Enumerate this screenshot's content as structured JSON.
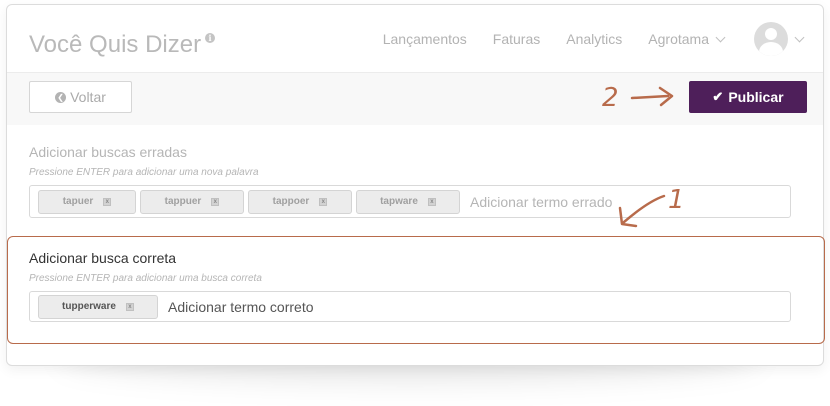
{
  "header": {
    "title": "Você Quis Dizer",
    "nav": [
      "Lançamentos",
      "Faturas",
      "Analytics"
    ],
    "account": "Agrotama"
  },
  "toolbar": {
    "back_label": "Voltar",
    "publish_label": "Publicar"
  },
  "wrong_section": {
    "label": "Adicionar buscas erradas",
    "hint": "Pressione ENTER para adicionar uma nova palavra",
    "tags": [
      "tapuer",
      "tappuer",
      "tappoer",
      "tapware"
    ],
    "placeholder": "Adicionar termo errado"
  },
  "correct_section": {
    "label": "Adicionar busca correta",
    "hint": "Pressione ENTER para adicionar uma busca correta",
    "tags": [
      "tupperware"
    ],
    "placeholder": "Adicionar termo correto"
  },
  "annotations": {
    "step_one": "1",
    "step_two": "2"
  },
  "colors": {
    "publish": "#4e1f5a",
    "annotation": "#b86b4b"
  },
  "icons": {
    "title_info": "info-icon",
    "back": "chevron-left-circle-icon",
    "publish": "check-icon",
    "account_dropdown": "chevron-down-icon",
    "avatar_dropdown": "chevron-down-icon"
  }
}
